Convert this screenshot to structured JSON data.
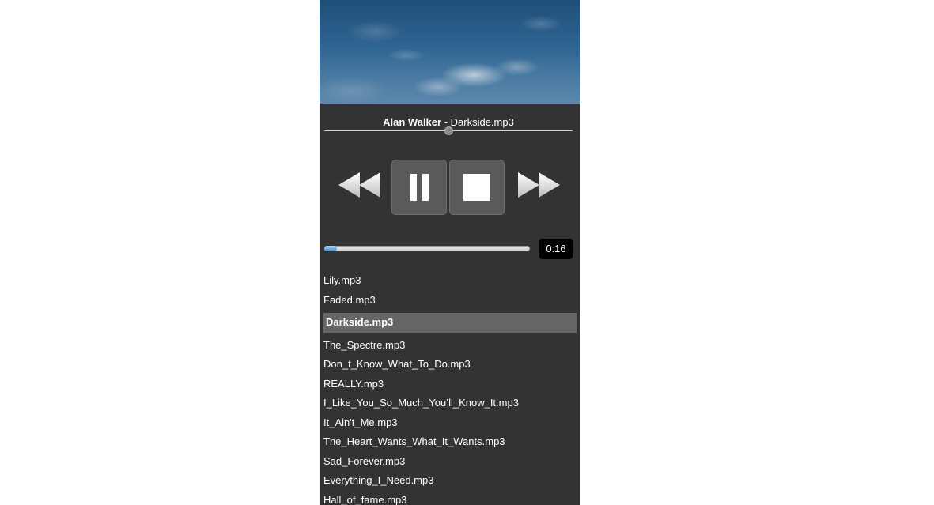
{
  "now_playing": {
    "artist": "Alan Walker",
    "separator": " - ",
    "title": "Darkside.mp3"
  },
  "volume": {
    "level": 0.5
  },
  "controls": {
    "rewind": "rewind-icon",
    "pause": "pause-icon",
    "stop": "stop-icon",
    "fast_forward": "fast-forward-icon"
  },
  "progress": {
    "fraction": 0.06,
    "time_label": "0:16"
  },
  "playlist": {
    "current_index": 2,
    "tracks": [
      "Lily.mp3",
      "Faded.mp3",
      "Darkside.mp3",
      "The_Spectre.mp3",
      "Don_t_Know_What_To_Do.mp3",
      "REALLY.mp3",
      "I_Like_You_So_Much_You’ll_Know_It.mp3",
      "It_Ain't_Me.mp3",
      "The_Heart_Wants_What_It_Wants.mp3",
      "Sad_Forever.mp3",
      "Everything_I_Need.mp3",
      "Hall_of_fame.mp3"
    ]
  },
  "colors": {
    "panel_background": "#333333",
    "selected_row": "#666666",
    "progress_fill": "#3d8fd6",
    "time_badge": "#000000"
  }
}
